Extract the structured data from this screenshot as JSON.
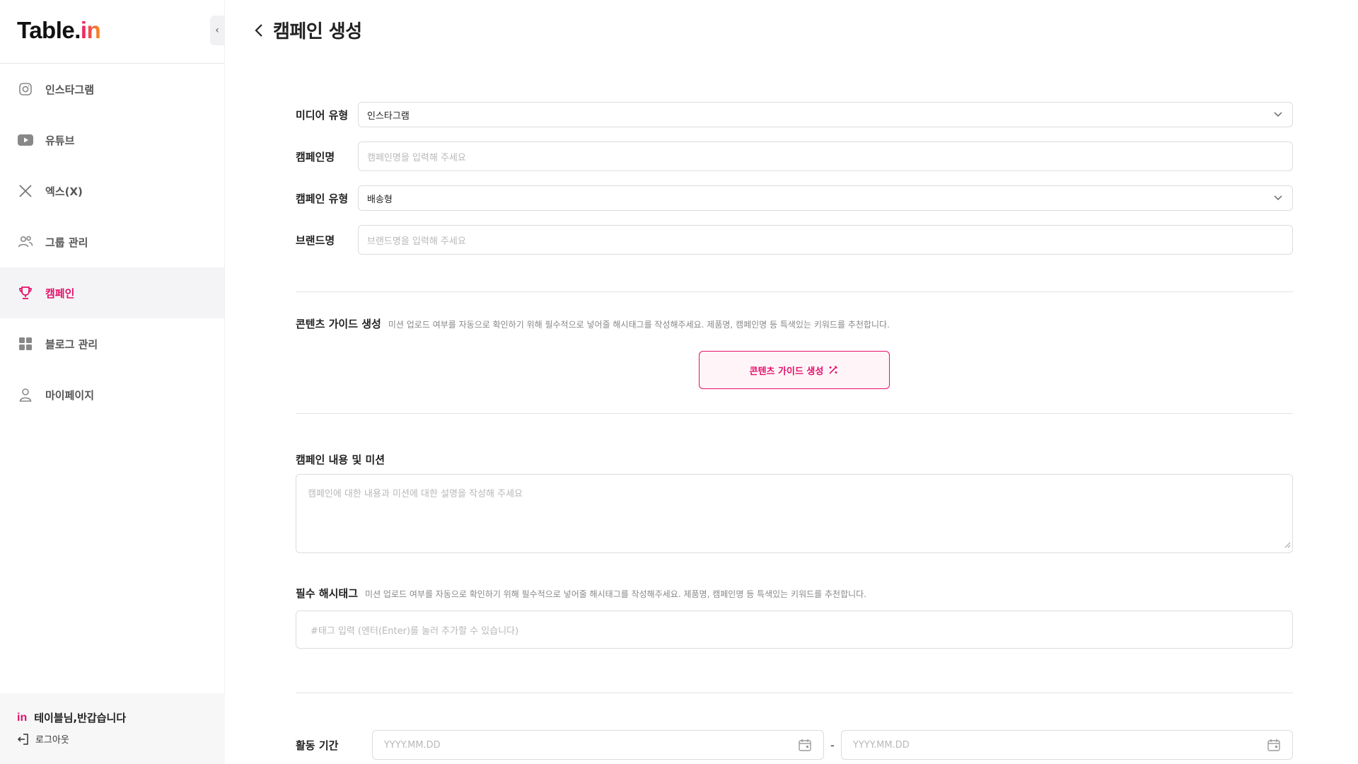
{
  "brand": {
    "logo_main": "Table.",
    "logo_accent": "in"
  },
  "sidebar": {
    "items": [
      {
        "label": "인스타그램",
        "icon": "instagram-icon"
      },
      {
        "label": "유튜브",
        "icon": "youtube-icon"
      },
      {
        "label": "엑스(X)",
        "icon": "x-icon"
      },
      {
        "label": "그룹 관리",
        "icon": "group-icon"
      },
      {
        "label": "캠페인",
        "icon": "trophy-icon",
        "active": true
      },
      {
        "label": "블로그 관리",
        "icon": "grid-icon"
      },
      {
        "label": "마이페이지",
        "icon": "user-icon"
      }
    ],
    "footer": {
      "mark": "in",
      "greeting": "테이블님,반갑습니다",
      "logout": "로그아웃"
    }
  },
  "page": {
    "title": "캠페인 생성"
  },
  "form": {
    "media_type": {
      "label": "미디어 유형",
      "value": "인스타그램"
    },
    "campaign_name": {
      "label": "캠페인명",
      "placeholder": "캠페인명을 입력해 주세요"
    },
    "campaign_type": {
      "label": "캠페인 유형",
      "value": "배송형"
    },
    "brand_name": {
      "label": "브랜드명",
      "placeholder": "브랜드명을 입력해 주세요"
    },
    "content_guide": {
      "title": "콘텐츠 가이드 생성",
      "desc": "미션 업로드 여부를 자동으로 확인하기 위해 필수적으로 넣어줄 해시태그를 작성해주세요. 제품명, 캠페인명 등 특색있는 키워드를 추천합니다.",
      "button": "콘텐츠 가이드 생성"
    },
    "campaign_content": {
      "title": "캠페인 내용 및 미션",
      "placeholder": "캠페인에 대한 내용과 미션에 대한 설명을 작성해 주세요"
    },
    "hashtags": {
      "title": "필수 해시태그",
      "desc": "미션 업로드 여부를 자동으로 확인하기 위해 필수적으로 넣어줄 해시태그를 작성해주세요. 제품명, 캠페인명 등 특색있는 키워드를 추천합니다.",
      "placeholder": "#태그 입력 (엔터(Enter)를 눌러 추가할 수 있습니다)"
    },
    "period": {
      "label": "활동 기간",
      "start_placeholder": "YYYY.MM.DD",
      "separator": "-",
      "end_placeholder": "YYYY.MM.DD"
    }
  },
  "colors": {
    "accent": "#e5106b",
    "accent_bg": "#fff5f8",
    "border": "#dcdcdc"
  }
}
